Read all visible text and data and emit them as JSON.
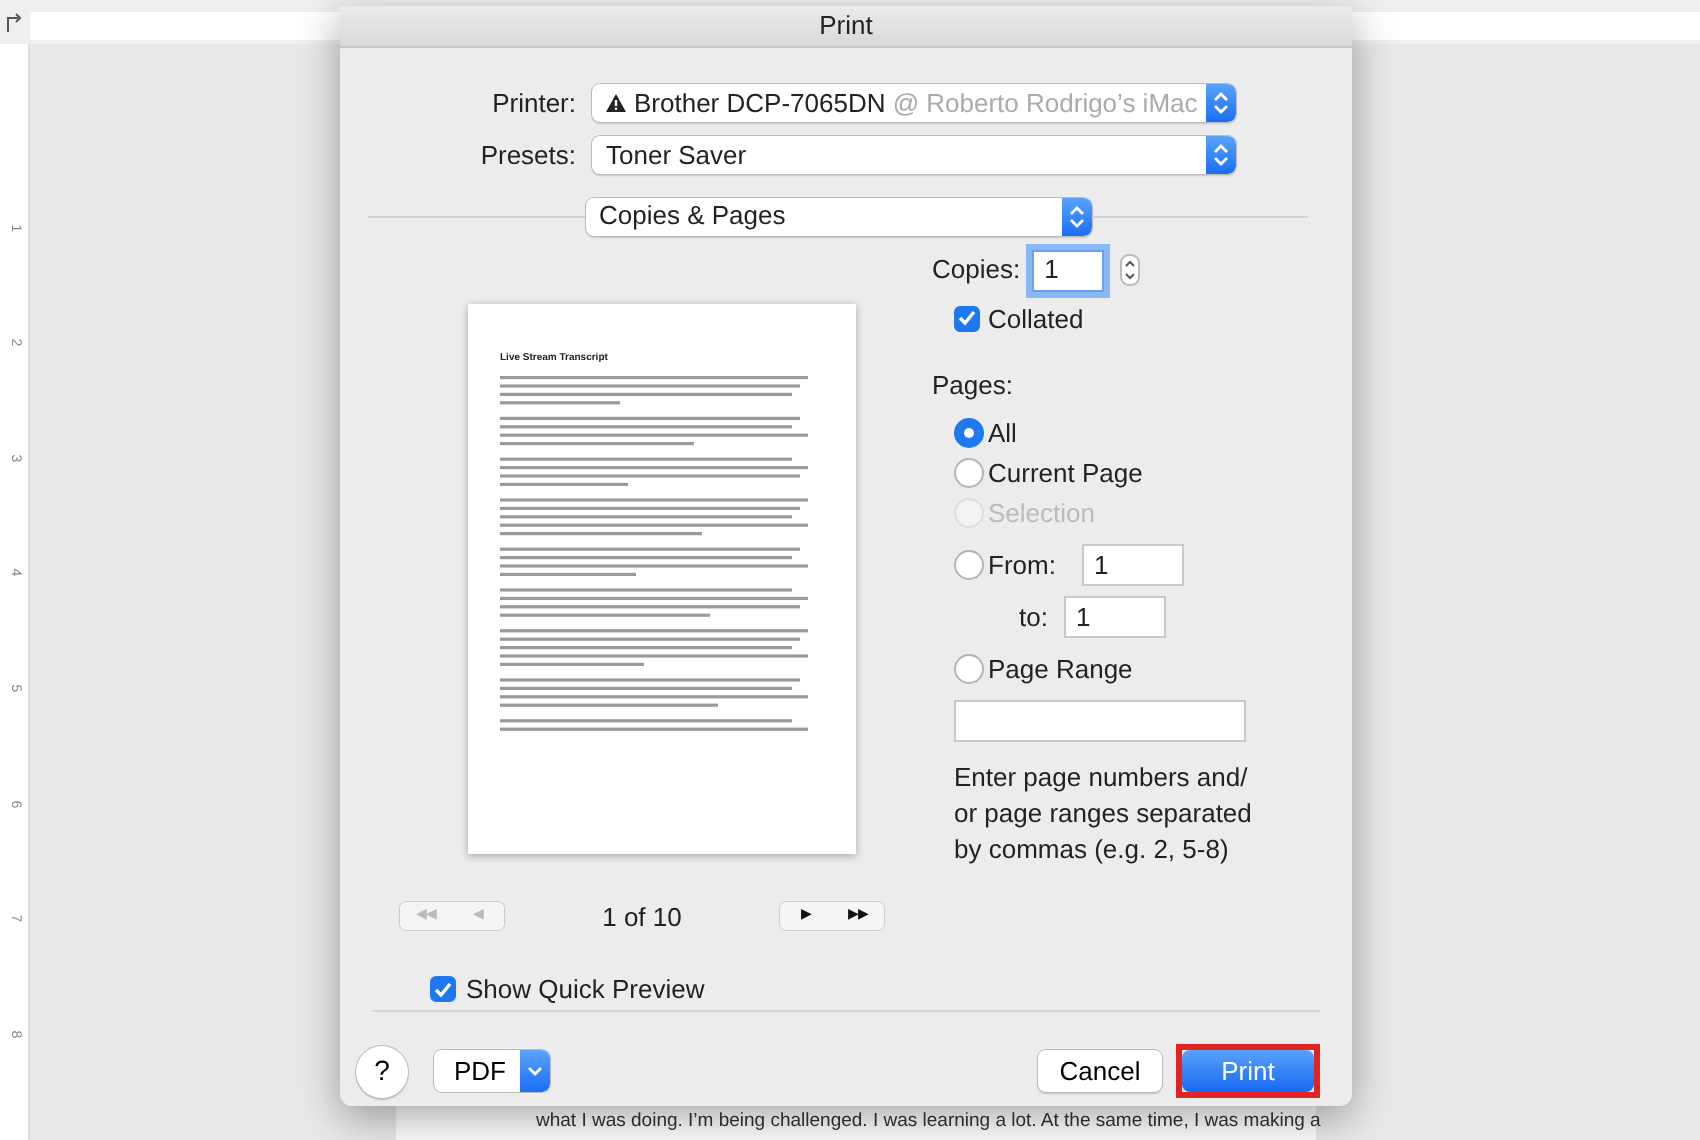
{
  "window": {
    "title": "Print"
  },
  "ruler": {
    "labels": [
      "1",
      "2",
      "3",
      "4",
      "5",
      "6",
      "7",
      "8"
    ]
  },
  "document": {
    "visible_line": "what I was doing. I’m being challenged. I was learning a lot. At the same time, I was making a"
  },
  "printer": {
    "label": "Printer:",
    "name": "Brother DCP-7065DN",
    "location": "@ Roberto Rodrigo’s iMac"
  },
  "presets": {
    "label": "Presets:",
    "value": "Toner Saver"
  },
  "panel": {
    "value": "Copies & Pages"
  },
  "preview": {
    "page_title": "Live Stream Transcript",
    "page_indicator": "1 of 10",
    "nav_buttons": [
      {
        "label": "◀◀",
        "disabled": true
      },
      {
        "label": "◀",
        "disabled": true
      },
      {
        "label": "▶",
        "disabled": false
      },
      {
        "label": "▶▶",
        "disabled": false
      }
    ]
  },
  "quick_preview": {
    "label": "Show Quick Preview",
    "checked": true
  },
  "copies": {
    "label": "Copies:",
    "value": "1",
    "focused": true
  },
  "collated": {
    "label": "Collated",
    "checked": true
  },
  "pages": {
    "label": "Pages:",
    "options": [
      {
        "kind": "plain",
        "label": "All",
        "selected": true,
        "disabled": false
      },
      {
        "kind": "plain",
        "label": "Current Page",
        "selected": false,
        "disabled": false
      },
      {
        "kind": "plain",
        "label": "Selection",
        "selected": false,
        "disabled": true
      },
      {
        "kind": "from",
        "label": "From:",
        "selected": false,
        "disabled": false,
        "value": "1",
        "to_label": "to:",
        "to_value": "1"
      },
      {
        "kind": "range",
        "label": "Page Range",
        "selected": false,
        "disabled": false
      }
    ]
  },
  "help_text": "Enter page numbers and/\nor page ranges separated\nby commas (e.g. 2, 5-8)",
  "footer": {
    "help": "?",
    "pdf": "PDF",
    "buttons": [
      {
        "label": "Cancel",
        "kind": "secondary",
        "highlighted": false
      },
      {
        "label": "Print",
        "kind": "default",
        "highlighted": true
      }
    ]
  }
}
